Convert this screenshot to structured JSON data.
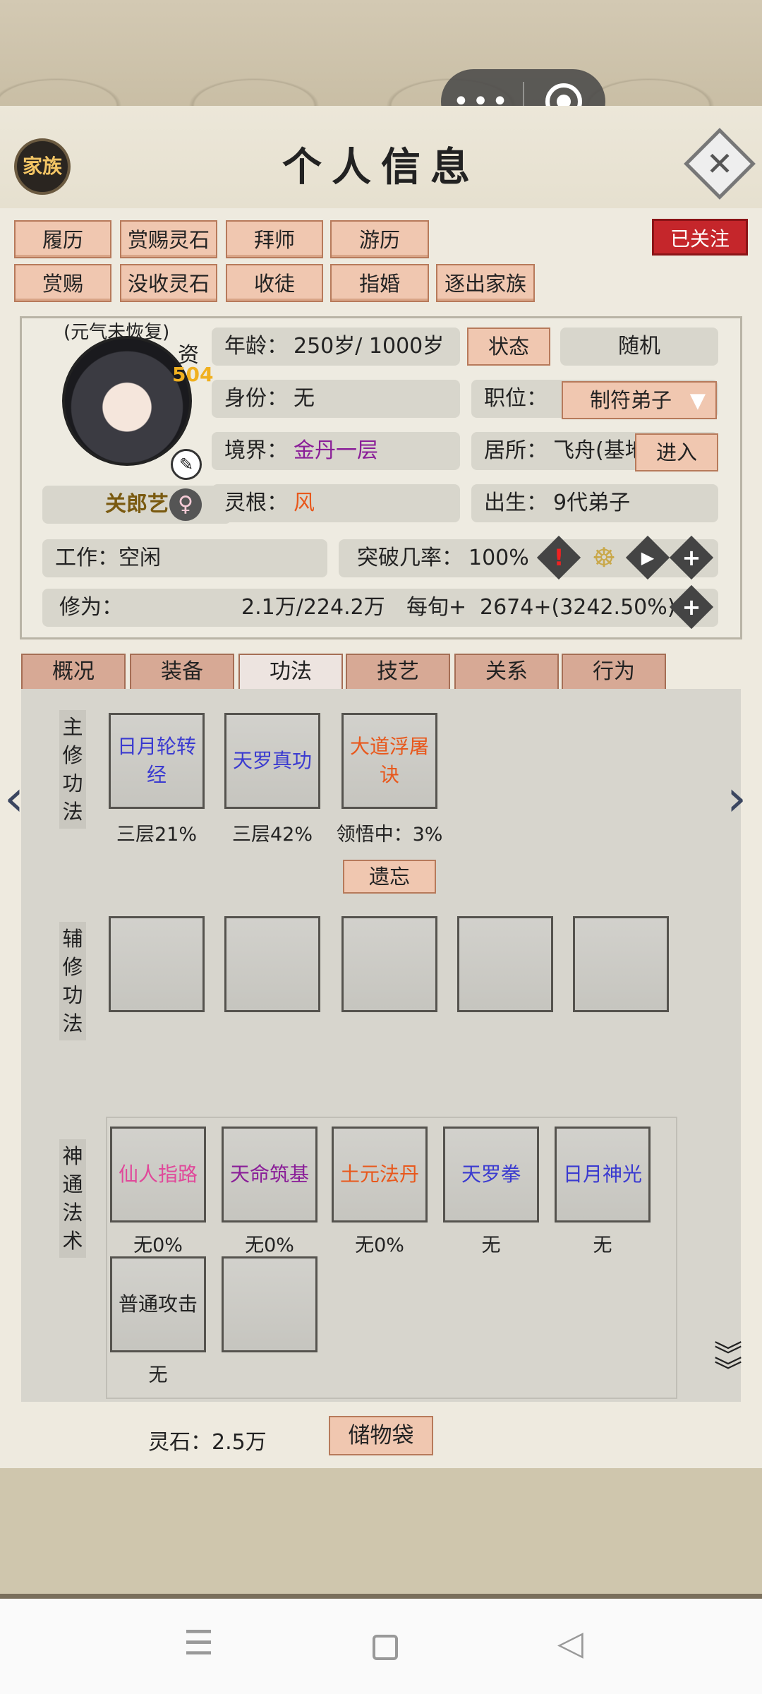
{
  "header": {
    "title": "个人信息",
    "family_button": "家族"
  },
  "capsule": {
    "more_icon": "•••",
    "target_icon": "target-icon"
  },
  "actions": {
    "row1": [
      "履历",
      "赏赐灵石",
      "拜师",
      "游历"
    ],
    "row2": [
      "赏赐",
      "没收灵石",
      "收徒",
      "指婚",
      "逐出家族"
    ],
    "followed": "已关注"
  },
  "profile": {
    "status_note": "(元气未恢复)",
    "aptitude_label": "资",
    "aptitude_value": "504",
    "name": "关郎艺",
    "gender_icon": "female-icon",
    "age_label": "年龄：",
    "age_value": "250岁/ 1000岁",
    "status_button": "状态",
    "random_button": "随机",
    "identity_label": "身份：",
    "identity_value": "无",
    "position_label": "职位：",
    "position_value": "制符弟子",
    "realm_label": "境界：",
    "realm_value": "金丹一层",
    "residence_label": "居所：",
    "residence_value": "飞舟(基地",
    "enter_button": "进入",
    "root_label": "灵根：",
    "root_value": "风",
    "birth_label": "出生：",
    "birth_value": "9代弟子",
    "work_label": "工作：",
    "work_value": "空闲",
    "breakthrough_label": "突破几率：",
    "breakthrough_value": "100%",
    "cultivation_label": "修为：",
    "cultivation_value": "2.1万/224.2万",
    "per_turn_label": "每旬+",
    "per_turn_value": "2674+(3242.50%)"
  },
  "tabs": [
    "概况",
    "装备",
    "功法",
    "技艺",
    "关系",
    "行为"
  ],
  "active_tab": "功法",
  "main_skills": {
    "label": "主修功法",
    "items": [
      {
        "name": "日月轮转经",
        "progress": "三层21%",
        "color": "#3a3ad0"
      },
      {
        "name": "天罗真功",
        "progress": "三层42%",
        "color": "#3a3ad0"
      },
      {
        "name": "大道浮屠诀",
        "progress": "领悟中：3%",
        "color": "#e8581c"
      }
    ],
    "forget_button": "遗忘"
  },
  "aux_skills": {
    "label": "辅修功法"
  },
  "spells": {
    "label": "神通法术",
    "items": [
      {
        "name": "仙人指路",
        "progress": "无0%",
        "color": "#e0489a"
      },
      {
        "name": "天命筑基",
        "progress": "无0%",
        "color": "#8a1e98"
      },
      {
        "name": "土元法丹",
        "progress": "无0%",
        "color": "#e8581c"
      },
      {
        "name": "天罗拳",
        "progress": "无",
        "color": "#3a3ad0"
      },
      {
        "name": "日月神光",
        "progress": "无",
        "color": "#3a3ad0"
      },
      {
        "name": "普通攻击",
        "progress": "无",
        "color": "#222222"
      }
    ]
  },
  "footer": {
    "spirit_stone_label": "灵石：",
    "spirit_stone_value": "2.5万",
    "bag_button": "储物袋"
  },
  "colors": {
    "accent_button": "#f0c7b0",
    "followed": "#c5262b",
    "realm": "#8a1e98",
    "root": "#e8581c"
  }
}
